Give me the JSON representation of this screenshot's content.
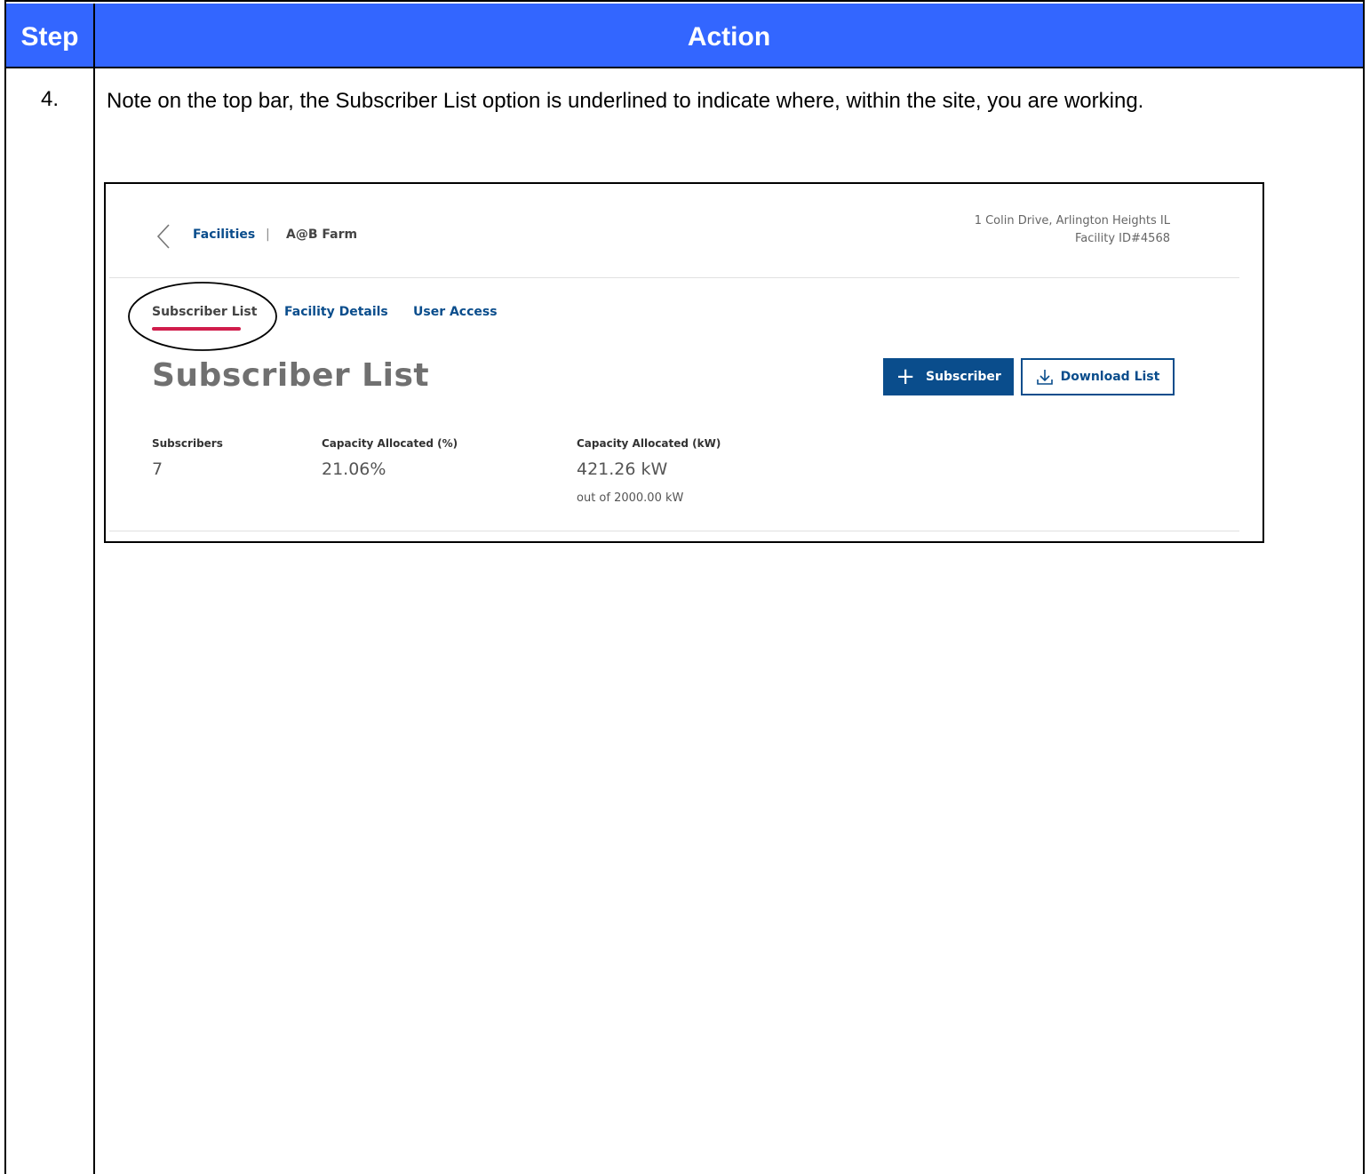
{
  "table": {
    "header": {
      "step": "Step",
      "action": "Action"
    },
    "row": {
      "step_number": "4.",
      "instruction": "Note on the top bar, the Subscriber List option is underlined to indicate where, within the site, you are working."
    }
  },
  "screenshot": {
    "breadcrumb": {
      "back_icon": "chevron-left-icon",
      "facilities": "Facilities",
      "separator": "|",
      "current": "A@B Farm"
    },
    "address": {
      "line1": "1 Colin Drive, Arlington Heights IL",
      "line2": "Facility ID#4568"
    },
    "tabs": [
      {
        "label": "Subscriber List",
        "active": true
      },
      {
        "label": "Facility Details",
        "active": false
      },
      {
        "label": "User Access",
        "active": false
      }
    ],
    "heading": "Subscriber List",
    "buttons": {
      "add_subscriber": {
        "icon": "plus-icon",
        "plus_glyph": "+",
        "label": "Subscriber"
      },
      "download_list": {
        "icon": "download-icon",
        "label": "Download List"
      }
    },
    "stats": [
      {
        "label": "Subscribers",
        "value": "7"
      },
      {
        "label": "Capacity Allocated (%)",
        "value": "21.06%"
      },
      {
        "label": "Capacity Allocated (kW)",
        "value": "421.26 kW",
        "sub": "out of 2000.00 kW"
      }
    ]
  },
  "colors": {
    "header_bg": "#3366ff",
    "brand_blue": "#0a4d8c",
    "active_tab_underline": "#d01c4b"
  }
}
